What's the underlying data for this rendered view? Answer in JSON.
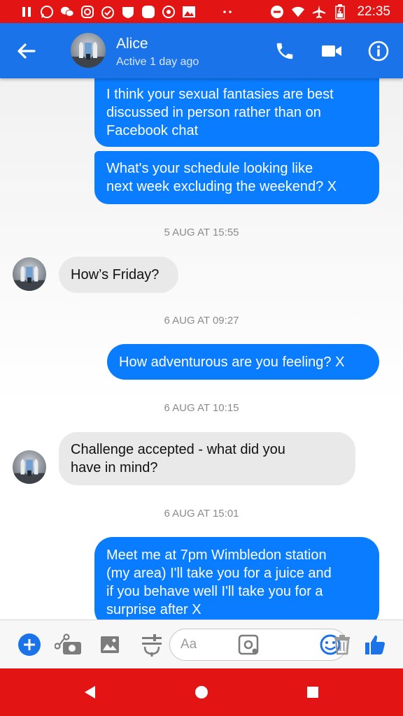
{
  "status_bar": {
    "time": "22:35",
    "left_icons": [
      "pause-icon",
      "whatsapp-icon",
      "wechat-icon",
      "instagram-icon",
      "timer-icon",
      "shield-icon",
      "app-icon",
      "settings-icon",
      "gallery-icon"
    ],
    "right_icons": [
      "do-not-disturb-icon",
      "wifi-icon",
      "airplane-icon",
      "battery-icon"
    ]
  },
  "header": {
    "contact_name": "Alice",
    "contact_status": "Active 1 day ago",
    "accent_color": "#1a73e8"
  },
  "messages": [
    {
      "type": "outgoing",
      "lines": [
        "I think your sexual fantasies are best",
        "discussed in person rather than on",
        "Facebook chat"
      ]
    },
    {
      "type": "outgoing",
      "lines": [
        "What's your schedule looking like",
        "next week excluding the weekend? X"
      ]
    },
    {
      "type": "timestamp",
      "text": "5 AUG AT 15:55"
    },
    {
      "type": "incoming",
      "lines": [
        "How’s Friday?"
      ]
    },
    {
      "type": "timestamp",
      "text": "6 AUG AT 09:27"
    },
    {
      "type": "outgoing",
      "lines": [
        "How adventurous are you feeling? X"
      ]
    },
    {
      "type": "timestamp",
      "text": "6 AUG AT 10:15"
    },
    {
      "type": "incoming",
      "lines": [
        "Challenge accepted - what did you",
        "have in mind?"
      ]
    },
    {
      "type": "timestamp",
      "text": "6 AUG AT 15:01"
    },
    {
      "type": "outgoing",
      "lines": [
        "Meet me at 7pm Wimbledon station",
        "(my area) I'll take you for a juice and",
        "if you behave well I'll take you for a",
        "surprise after X"
      ]
    }
  ],
  "composer": {
    "placeholder": "Aa",
    "icons": [
      "add-icon",
      "camera-icon",
      "image-icon",
      "mic-icon",
      "sticker-icon",
      "emoji-icon",
      "delete-icon",
      "like-icon"
    ]
  },
  "colors": {
    "outgoing_bubble": "#0a7cff",
    "incoming_bubble": "#e9e9e9",
    "status_bar": "#e21414"
  }
}
